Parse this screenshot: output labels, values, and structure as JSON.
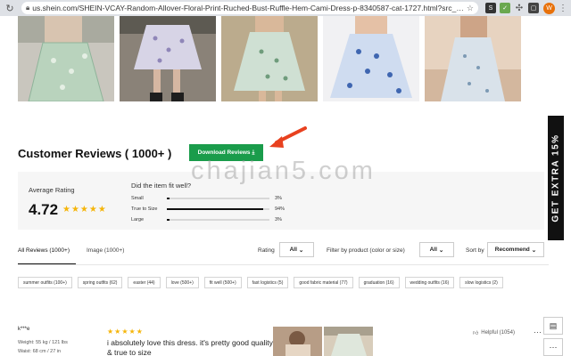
{
  "browser": {
    "url": "us.shein.com/SHEIN-VCAY-Random-Allover-Floral-Print-Ruched-Bust-Ruffle-Hem-Cami-Dress-p-8340587-cat-1727.html?src_identi...",
    "avatar_letter": "W"
  },
  "reviews": {
    "title": "Customer Reviews ( 1000+ )",
    "download_label": "Download Reviews",
    "average_label": "Average Rating",
    "average_value": "4.72",
    "average_stars": "★★★★★",
    "fit_question": "Did the item fit well?",
    "fit": [
      {
        "label": "Small",
        "percent": "3%",
        "value": 3
      },
      {
        "label": "True to Size",
        "percent": "94%",
        "value": 94
      },
      {
        "label": "Large",
        "percent": "3%",
        "value": 3
      }
    ]
  },
  "tabs": {
    "all": "All Reviews (1000+)",
    "image": "Image (1000+)"
  },
  "filters": {
    "rating_label": "Rating",
    "rating_value": "All",
    "product_label": "Filter by product  (color or size)",
    "product_value": "All",
    "sort_label": "Sort by",
    "sort_value": "Recommend"
  },
  "tags": [
    "summer outfits (100+)",
    "spring outfits (62)",
    "easter (44)",
    "love (500+)",
    "fit well (500+)",
    "fast logistics (5)",
    "good fabric material (77)",
    "graduation (16)",
    "wedding outfits (16)",
    "slow logistics (2)"
  ],
  "review": {
    "name": "k***e",
    "weight": "Weight: 55 kg / 121 lbs",
    "waist": "Waist: 68 cm / 27 in",
    "stars": "★★★★★",
    "text": "i absolutely love this dress. it's pretty good quality & true to size",
    "helpful": "Helpful (1054)",
    "more": "···"
  },
  "side": {
    "extra_label": "GET EXTRA 15%"
  },
  "watermark": "chajian5.com",
  "colors": {
    "download_button": "#1a9c4b",
    "arrow": "#e8411f",
    "star": "#f5b50a"
  }
}
